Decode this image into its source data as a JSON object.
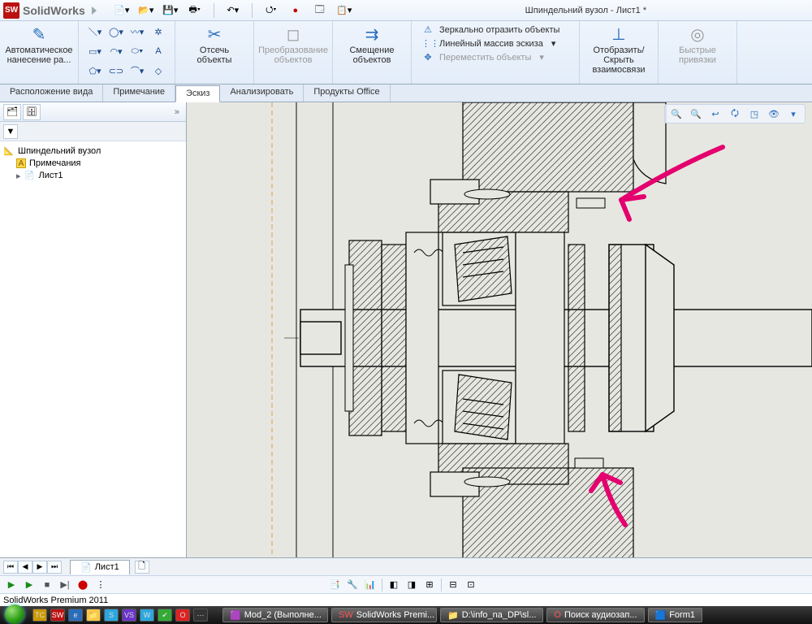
{
  "app": {
    "brand": "SolidWorks",
    "document_title": "Шпиндельний вузол - Лист1 *"
  },
  "qat": {
    "new": "new",
    "open": "open",
    "save": "save",
    "print": "print",
    "undo": "undo",
    "select": "select",
    "rebuild": "rebuild",
    "options": "options",
    "appearance": "appearance"
  },
  "ribbon": {
    "auto_dim": "Автоматическое\nнанесение ра...",
    "trim": "Отсечь\nобъекты",
    "convert": "Преобразование\nобъектов",
    "offset": "Смещение\nобъектов",
    "mirror": "Зеркально отразить объекты",
    "linear": "Линейный массив эскиза",
    "move": "Переместить объекты",
    "display": "Отобразить/Скрыть\nвзаимосвязи",
    "snaps": "Быстрые\nпривязки"
  },
  "tabs": {
    "t1": "Расположение вида",
    "t2": "Примечание",
    "t3": "Эскиз",
    "t4": "Анализировать",
    "t5": "Продукты Office"
  },
  "tree": {
    "root": "Шпиндельний вузол",
    "annotations": "Примечания",
    "sheet1": "Лист1"
  },
  "sheet": {
    "tab1": "Лист1"
  },
  "status": {
    "edition": "SolidWorks Premium 2011"
  },
  "taskbar": {
    "t1": "Mod_2 (Выполне...",
    "t2": "SolidWorks Premi...",
    "t3": "D:\\info_na_DP\\sl...",
    "t4": "Поиск аудиозап...",
    "t5": "Form1"
  }
}
